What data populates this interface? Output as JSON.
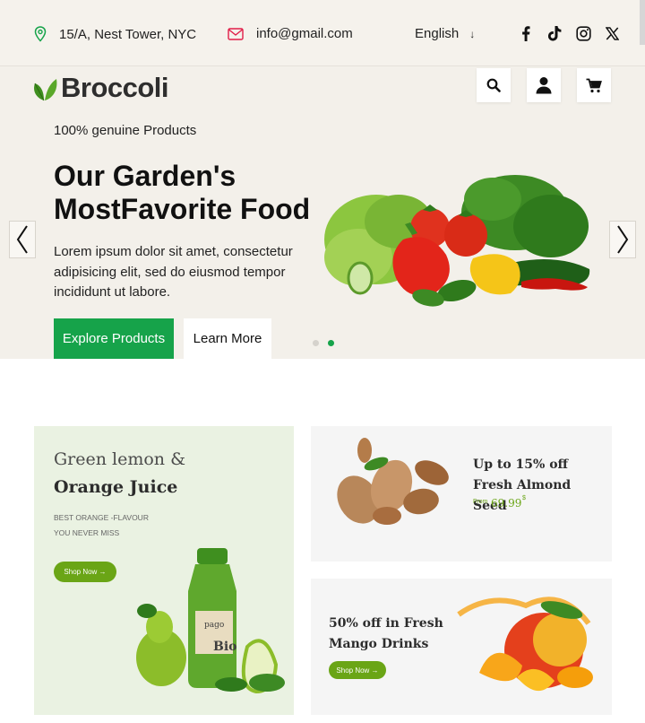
{
  "topbar": {
    "address": "15/A, Nest Tower, NYC",
    "email": "info@gmail.com",
    "language": "English",
    "language_arrow": "↓",
    "social": [
      "facebook-icon",
      "tiktok-icon",
      "instagram-icon",
      "x-icon"
    ]
  },
  "header": {
    "brand": "Broccoli",
    "icons": [
      "search-icon",
      "user-icon",
      "cart-icon"
    ]
  },
  "hero": {
    "tagline": "100% genuine Products",
    "title": "Our Garden's MostFavorite Food",
    "description": "Lorem ipsum dolor sit amet, consectetur adipisicing elit, sed do eiusmod tempor incididunt ut labore.",
    "primary_button": "Explore Products",
    "secondary_button": "Learn More",
    "slides": 2,
    "active_slide": 2
  },
  "promos": {
    "lemon": {
      "line1": "Green lemon &",
      "line2": "Orange Juice",
      "sub": "BEST ORANGE -FLAVOUR YOU NEVER MISS",
      "button": "Shop Now →",
      "bottle_label": "Bio"
    },
    "almond": {
      "title": "Up to 15% off Fresh Almond Seed",
      "from": "From",
      "price": "69.99",
      "currency": "$"
    },
    "mango": {
      "title": "50% off in Fresh Mango Drinks",
      "button": "Shop Now →"
    }
  },
  "colors": {
    "accent": "#16a34a",
    "shop_button": "#6aa516",
    "hero_bg": "#f3f0ea",
    "lemon_card_bg": "#eaf2e2",
    "card_bg": "#f5f5f5"
  }
}
